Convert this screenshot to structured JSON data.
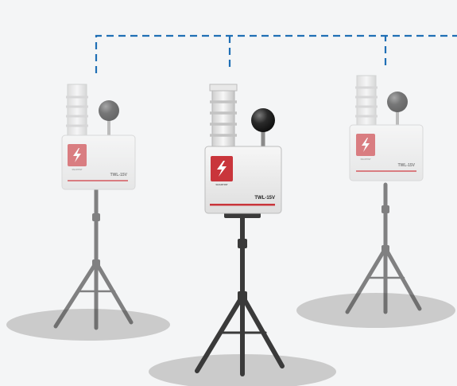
{
  "devices": [
    {
      "model": "TWL-15V",
      "brand": "SNARTINT",
      "position": "left",
      "focus": "faded"
    },
    {
      "model": "TWL-15V",
      "brand": "SNARTINT",
      "position": "center",
      "focus": "sharp"
    },
    {
      "model": "TWL-15V",
      "brand": "SNARTINT",
      "position": "right",
      "focus": "faded"
    }
  ],
  "colors": {
    "background": "#f4f5f6",
    "connector": "#1f6fb5",
    "logo": "#c9353b",
    "box": "#ececec",
    "tripod": "#3a3a3a",
    "ground_shadow": "#cbcbcb",
    "globe": "#2a2a2a"
  },
  "icons": {
    "logo_mark": "lightning-bolt-logo-icon",
    "globe": "black-globe-sensor-icon",
    "radiation_shield": "radiation-shield-icon"
  },
  "connector_style": "dashed"
}
